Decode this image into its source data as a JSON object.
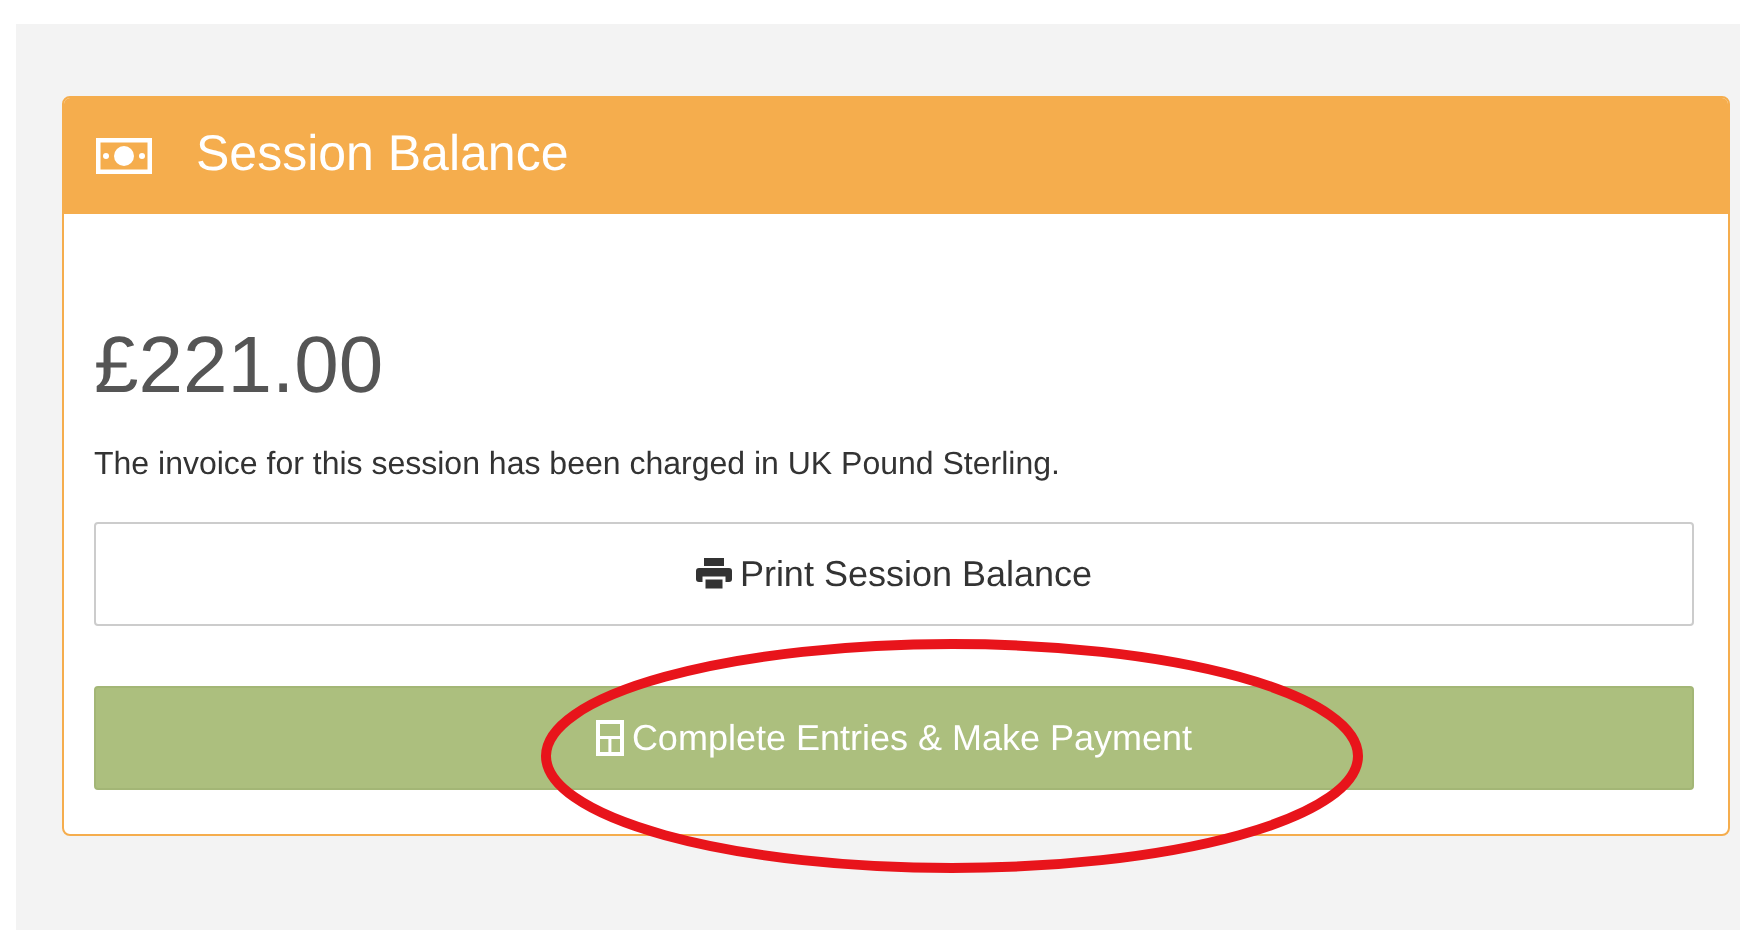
{
  "panel": {
    "title": "Session Balance"
  },
  "amount": "£221.00",
  "note": "The invoice for this session has been charged in UK Pound Sterling.",
  "buttons": [
    {
      "kind": "print",
      "label": "Print Session Balance"
    },
    {
      "kind": "pay",
      "label": "Complete Entries & Make Payment"
    }
  ],
  "annotation": {
    "kind": "ellipse",
    "color": "#e8141b"
  }
}
